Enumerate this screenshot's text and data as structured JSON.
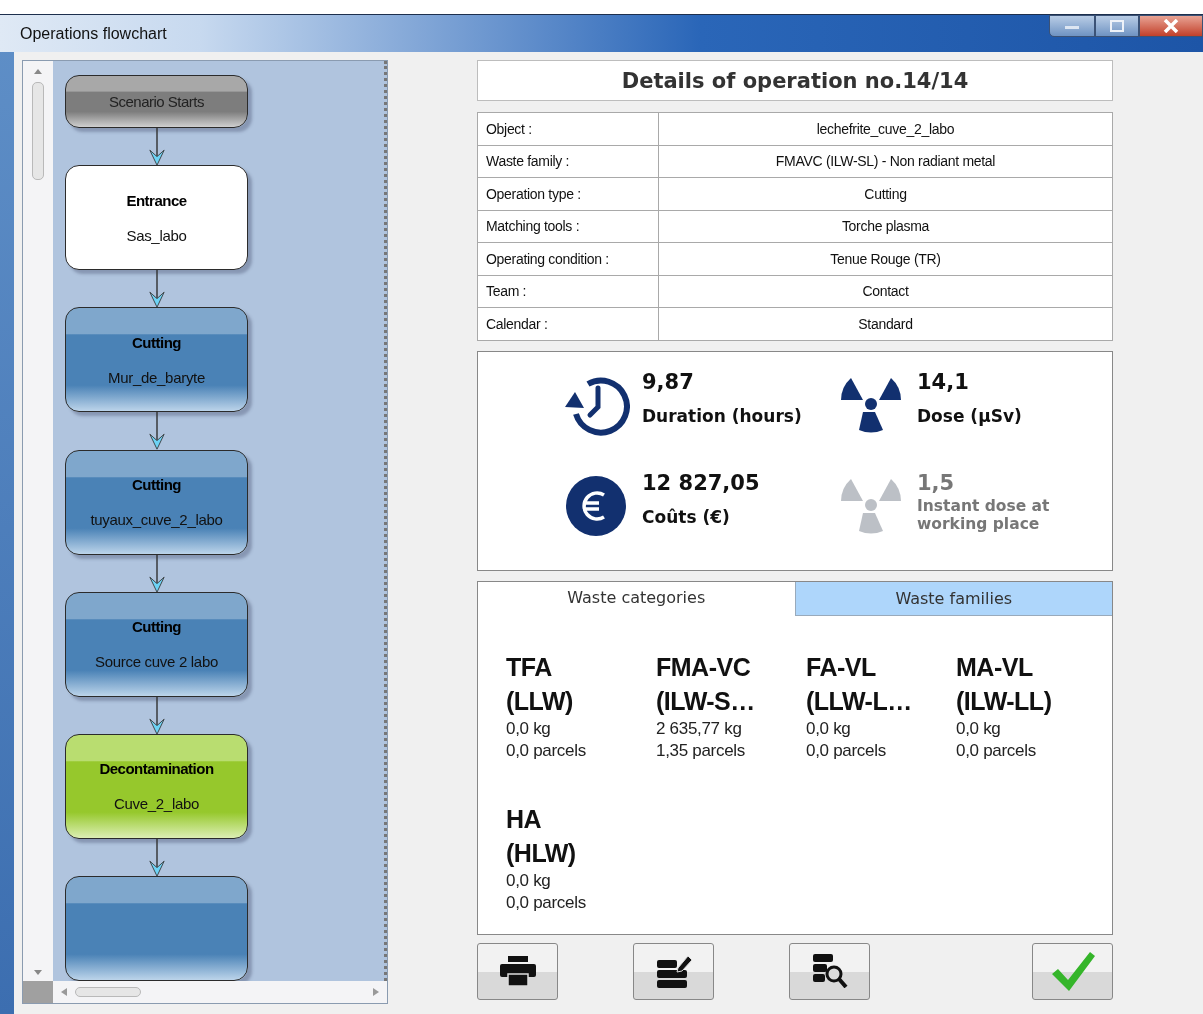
{
  "window": {
    "title": "Operations flowchart"
  },
  "flowchart": {
    "nodes": [
      {
        "kind": "start",
        "title": "Scenario Starts"
      },
      {
        "kind": "entrance",
        "title": "Entrance",
        "subtitle": "Sas_labo"
      },
      {
        "kind": "cutting",
        "title": "Cutting",
        "subtitle": "Mur_de_baryte"
      },
      {
        "kind": "cutting",
        "title": "Cutting",
        "subtitle": "tuyaux_cuve_2_labo"
      },
      {
        "kind": "cutting",
        "title": "Cutting",
        "subtitle": "Source cuve 2 labo"
      },
      {
        "kind": "decontamination",
        "title": "Decontamination",
        "subtitle": "Cuve_2_labo"
      },
      {
        "kind": "cutting"
      }
    ]
  },
  "details": {
    "title": "Details of operation no.14/14",
    "rows": [
      {
        "label": "Object :",
        "value": "lechefrite_cuve_2_labo"
      },
      {
        "label": "Waste family :",
        "value": "FMAVC (ILW-SL) - Non radiant metal"
      },
      {
        "label": "Operation type :",
        "value": "Cutting"
      },
      {
        "label": "Matching tools :",
        "value": "Torche plasma"
      },
      {
        "label": "Operating condition :",
        "value": "Tenue Rouge (TR)"
      },
      {
        "label": "Team :",
        "value": "Contact"
      },
      {
        "label": "Calendar :",
        "value": "Standard"
      }
    ]
  },
  "stats": [
    {
      "kind": "clock",
      "value": "9,87",
      "label": "Duration (hours)",
      "muted": false
    },
    {
      "kind": "radiation",
      "value": "14,1",
      "label": "Dose (µSv)",
      "muted": false
    },
    {
      "kind": "euro",
      "value": "12 827,05",
      "label": "Coûts (€)",
      "muted": false
    },
    {
      "kind": "radiation",
      "value": "1,5",
      "label": "Instant dose at working place",
      "muted": true
    }
  ],
  "tabs": [
    {
      "label": "Waste categories",
      "selected": true
    },
    {
      "label": "Waste families",
      "selected": false
    }
  ],
  "waste_categories": [
    {
      "code": "TFA",
      "name": "(LLW)",
      "mass": "0,0 kg",
      "parcels": "0,0 parcels"
    },
    {
      "code": "FMA-VC",
      "name": "(ILW-S…",
      "mass": "2 635,77 kg",
      "parcels": "1,35 parcels"
    },
    {
      "code": "FA-VL",
      "name": "(LLW-L…",
      "mass": "0,0 kg",
      "parcels": "0,0 parcels"
    },
    {
      "code": "MA-VL",
      "name": "(ILW-LL)",
      "mass": "0,0 kg",
      "parcels": "0,0 parcels"
    },
    {
      "code": "HA",
      "name": "(HLW)",
      "mass": "0,0 kg",
      "parcels": "0,0 parcels"
    }
  ],
  "buttons": [
    {
      "kind": "print"
    },
    {
      "kind": "edit"
    },
    {
      "kind": "search"
    },
    {
      "kind": "confirm"
    }
  ]
}
